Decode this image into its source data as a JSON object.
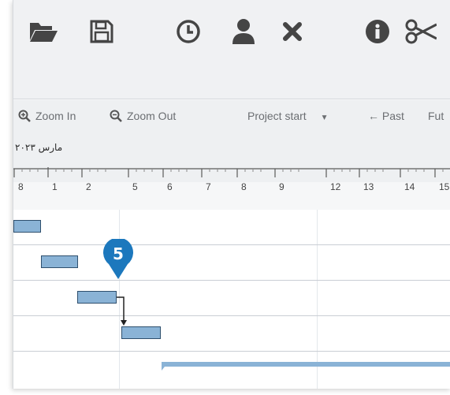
{
  "toolbar": {
    "buttons": [
      {
        "name": "open-folder-icon"
      },
      {
        "name": "save-icon"
      },
      {
        "name": "clock-icon"
      },
      {
        "name": "user-icon"
      },
      {
        "name": "close-icon"
      },
      {
        "name": "info-icon"
      },
      {
        "name": "scissors-icon"
      }
    ]
  },
  "view": {
    "zoom_in": "Zoom In",
    "zoom_out": "Zoom Out",
    "project_start": "Project start",
    "past": "← Past",
    "future": "Fut"
  },
  "timeline": {
    "date_label": "مارس ٢٠٢٣",
    "ticks": [
      "8",
      "1",
      "2",
      "5",
      "6",
      "7",
      "8",
      "9",
      "12",
      "13",
      "14",
      "15"
    ]
  },
  "callout": {
    "number": "5"
  },
  "colors": {
    "bar_fill": "#8ab3d6",
    "bar_border": "#2e4f6d",
    "callout": "#1c78bd",
    "icon": "#454545"
  }
}
